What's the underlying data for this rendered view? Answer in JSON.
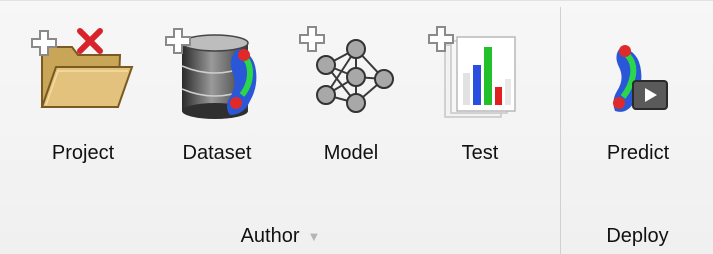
{
  "ribbon": {
    "groups": [
      {
        "label": "Author",
        "items": [
          {
            "label": "Project",
            "icon": "folder-remove-icon"
          },
          {
            "label": "Dataset",
            "icon": "database-add-icon"
          },
          {
            "label": "Model",
            "icon": "neural-network-add-icon"
          },
          {
            "label": "Test",
            "icon": "chart-report-add-icon"
          }
        ]
      },
      {
        "label": "Deploy",
        "items": [
          {
            "label": "Predict",
            "icon": "predict-play-icon"
          }
        ]
      }
    ]
  }
}
